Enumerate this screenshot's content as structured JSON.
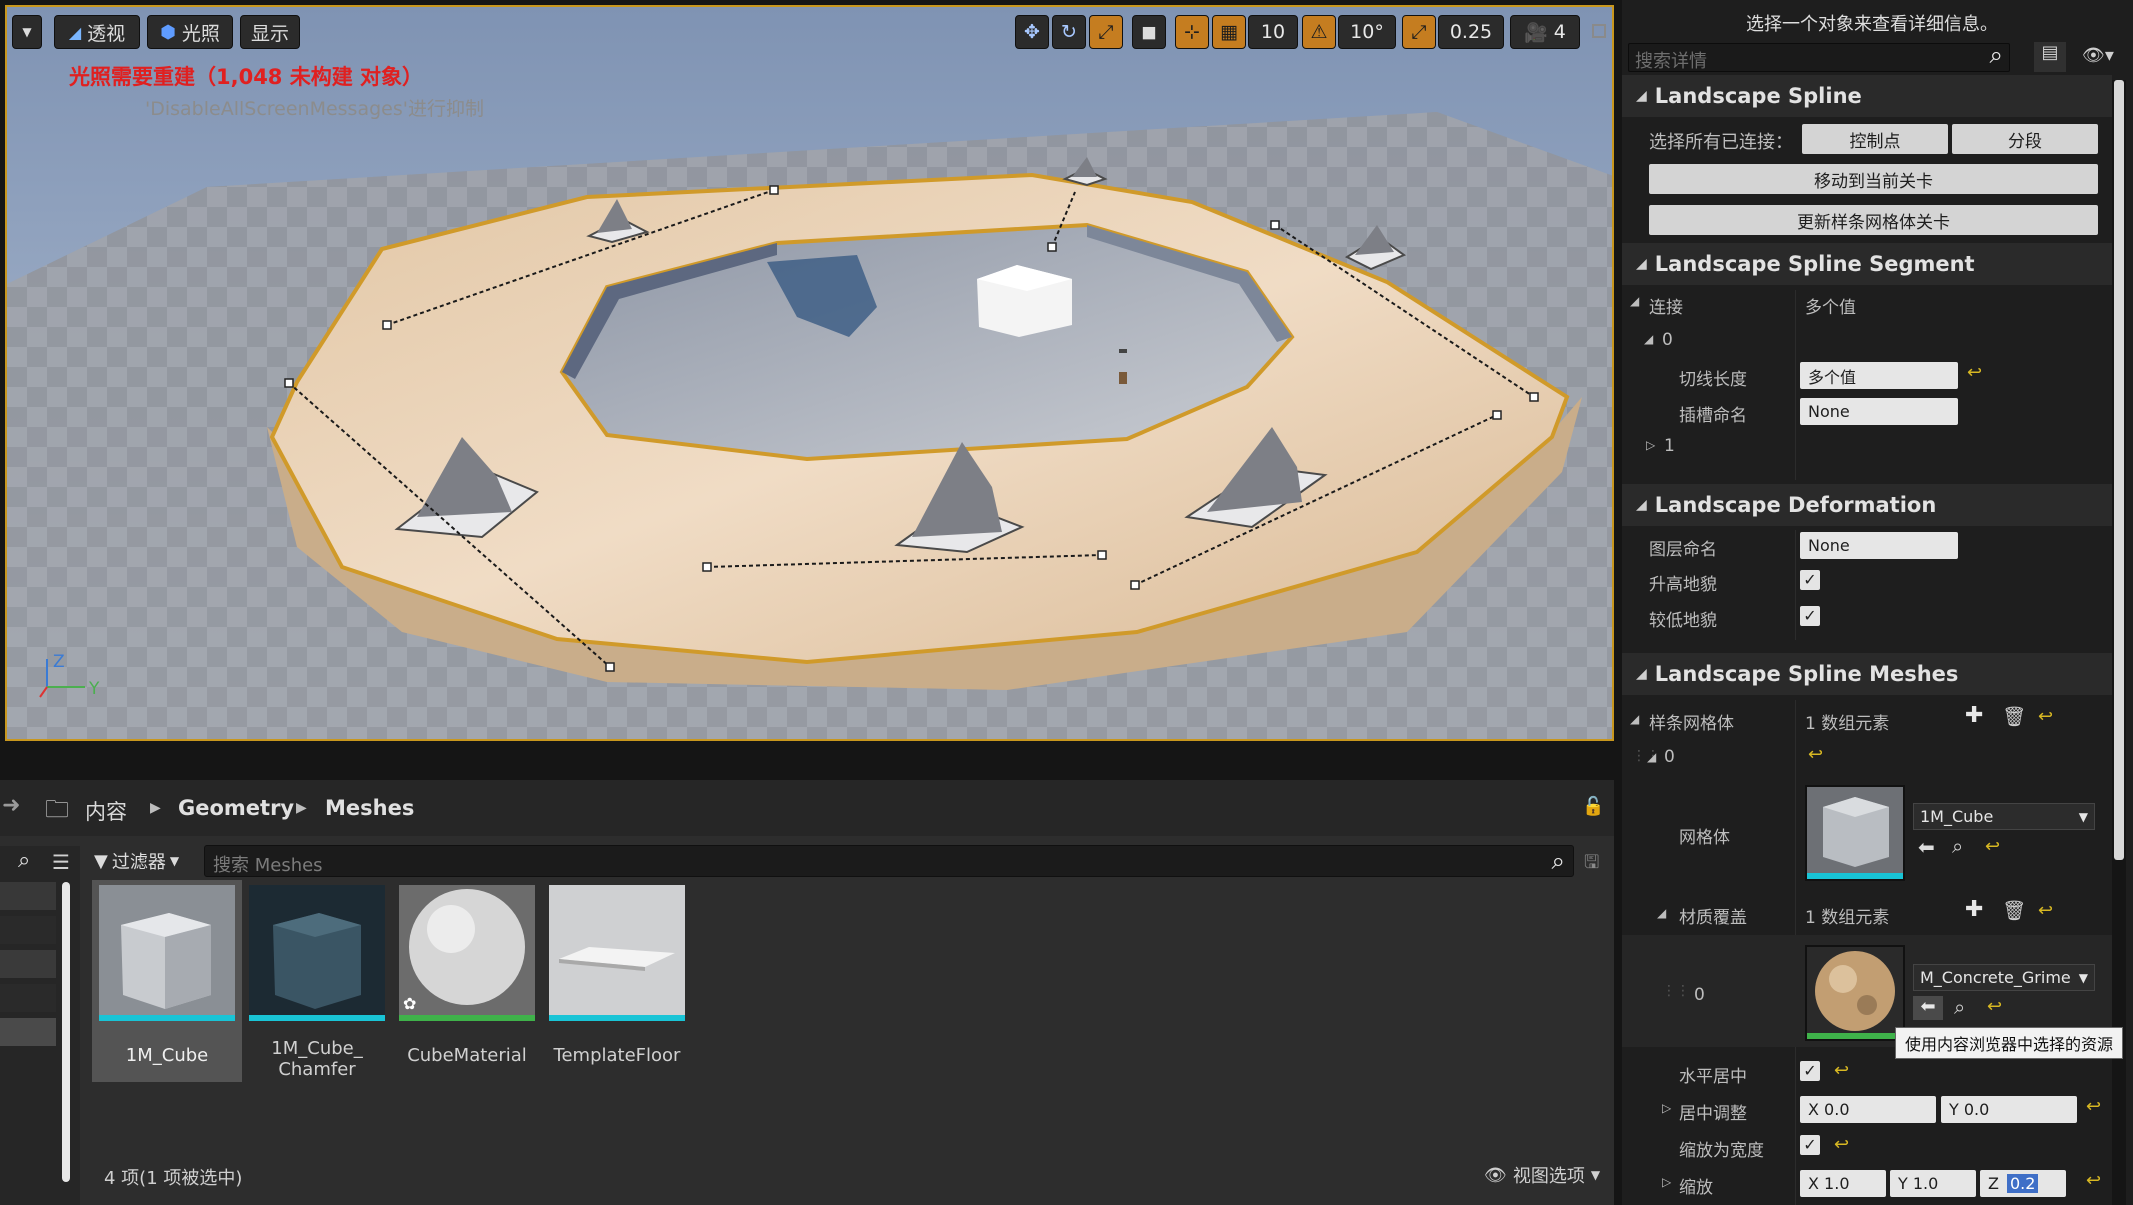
{
  "viewport": {
    "toolbar": {
      "menu_arrow": "chevron-down-icon",
      "perspective_label": "透视",
      "lit_label": "光照",
      "show_label": "显示",
      "grid_snap_value": "10",
      "rotate_snap_value": "10°",
      "scale_snap_value": "0.25",
      "camera_speed_value": "4"
    },
    "warning_text": "光照需要重建（1,048 未构建 对象）",
    "suppress_text": "'DisableAllScreenMessages'进行抑制",
    "axis_labels": {
      "z": "Z",
      "y": "Y"
    },
    "colors": {
      "selection": "#c8971e",
      "warning": "#e02020"
    }
  },
  "details": {
    "hint": "选择一个对象来查看详细信息。",
    "search_placeholder": "搜索详情",
    "spline": {
      "title": "Landscape Spline",
      "select_connected_label": "选择所有已连接：",
      "control_points_button": "控制点",
      "segments_button": "分段",
      "move_to_level_button": "移动到当前关卡",
      "update_mesh_level_button": "更新样条网格体关卡"
    },
    "segment": {
      "title": "Landscape Spline Segment",
      "connections_label": "连接",
      "connections_value": "多个值",
      "index0": "0",
      "tangent_label": "切线长度",
      "tangent_value": "多个值",
      "socket_label": "插槽命名",
      "socket_value": "None",
      "index1": "1"
    },
    "deformation": {
      "title": "Landscape Deformation",
      "layer_label": "图层命名",
      "layer_value": "None",
      "raise_label": "升高地貌",
      "lower_label": "较低地貌"
    },
    "meshes": {
      "title": "Landscape Spline Meshes",
      "spline_meshes_label": "样条网格体",
      "spline_meshes_count": "1 数组元素",
      "index0": "0",
      "mesh_label": "网格体",
      "mesh_value": "1M_Cube",
      "material_override_label": "材质覆盖",
      "material_override_count": "1 数组元素",
      "material_index": "0",
      "material_value": "M_Concrete_Grime",
      "tooltip": "使用内容浏览器中选择的资源",
      "center_h_label": "水平居中",
      "center_adjust_label": "居中调整",
      "center_adjust_x": "X  0.0",
      "center_adjust_y": "Y  0.0",
      "scale_to_width_label": "缩放为宽度",
      "scale_label": "缩放",
      "scale_x": "X  1.0",
      "scale_y": "Y  1.0",
      "scale_z_prefix": "Z",
      "scale_z": "0.2"
    }
  },
  "content_browser": {
    "breadcrumb": [
      "内容",
      "Geometry",
      "Meshes"
    ],
    "filter_label": "过滤器",
    "search_placeholder": "搜索 Meshes",
    "assets": [
      {
        "name": "1M_Cube",
        "selected": true
      },
      {
        "name": "1M_Cube_\nChamfer",
        "selected": false
      },
      {
        "name": "CubeMaterial",
        "selected": false
      },
      {
        "name": "TemplateFloor",
        "selected": false
      }
    ],
    "status": "4 项(1 项被选中)",
    "view_options_label": "视图选项"
  }
}
